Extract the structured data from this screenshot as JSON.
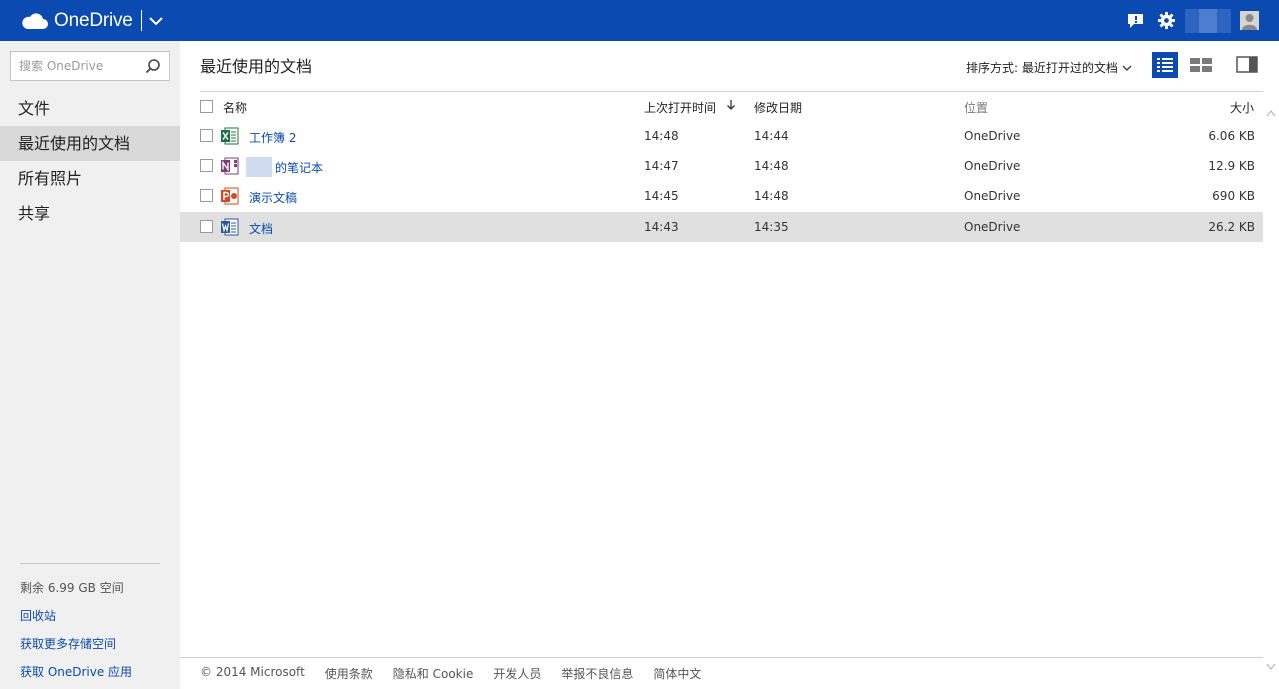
{
  "app": {
    "name": "OneDrive"
  },
  "sidebar": {
    "search_placeholder": "搜索 OneDrive",
    "nav_items": [
      {
        "label": "文件",
        "active": false
      },
      {
        "label": "最近使用的文档",
        "active": true
      },
      {
        "label": "所有照片",
        "active": false
      },
      {
        "label": "共享",
        "active": false
      }
    ],
    "quota": "剩余 6.99 GB 空间",
    "links": [
      "回收站",
      "获取更多存储空间",
      "获取 OneDrive 应用"
    ]
  },
  "main": {
    "title": "最近使用的文档",
    "sort_label": "排序方式: 最近打开过的文档",
    "columns": {
      "name": "名称",
      "last_opened": "上次打开时间",
      "modified": "修改日期",
      "location": "位置",
      "size": "大小"
    },
    "files": [
      {
        "name": "工作簿 2",
        "type": "excel",
        "icon": "excel-icon",
        "opened": "14:48",
        "modified": "14:44",
        "location": "OneDrive",
        "size": "6.06 KB",
        "highlight": false
      },
      {
        "name": "的笔记本",
        "type": "onenote",
        "icon": "onenote-icon",
        "opened": "14:47",
        "modified": "14:48",
        "location": "OneDrive",
        "size": "12.9 KB",
        "highlight": false
      },
      {
        "name": "演示文稿",
        "type": "powerpoint",
        "icon": "powerpoint-icon",
        "opened": "14:45",
        "modified": "14:48",
        "location": "OneDrive",
        "size": "690 KB",
        "highlight": false
      },
      {
        "name": "文档",
        "type": "word",
        "icon": "word-icon",
        "opened": "14:43",
        "modified": "14:35",
        "location": "OneDrive",
        "size": "26.2 KB",
        "highlight": true
      }
    ]
  },
  "footer": {
    "items": [
      "© 2014 Microsoft",
      "使用条款",
      "隐私和 Cookie",
      "开发人员",
      "举报不良信息",
      "简体中文"
    ]
  },
  "colors": {
    "topbar": "#0b4ab0",
    "link": "#0b4ab0",
    "sidebar_bg": "#f0f0f0",
    "active_nav": "#d8d8d8",
    "row_highlight": "#e0e0e0",
    "excel": "#1e7145",
    "onenote": "#80397b",
    "powerpoint": "#d24726",
    "word": "#2b579a"
  }
}
